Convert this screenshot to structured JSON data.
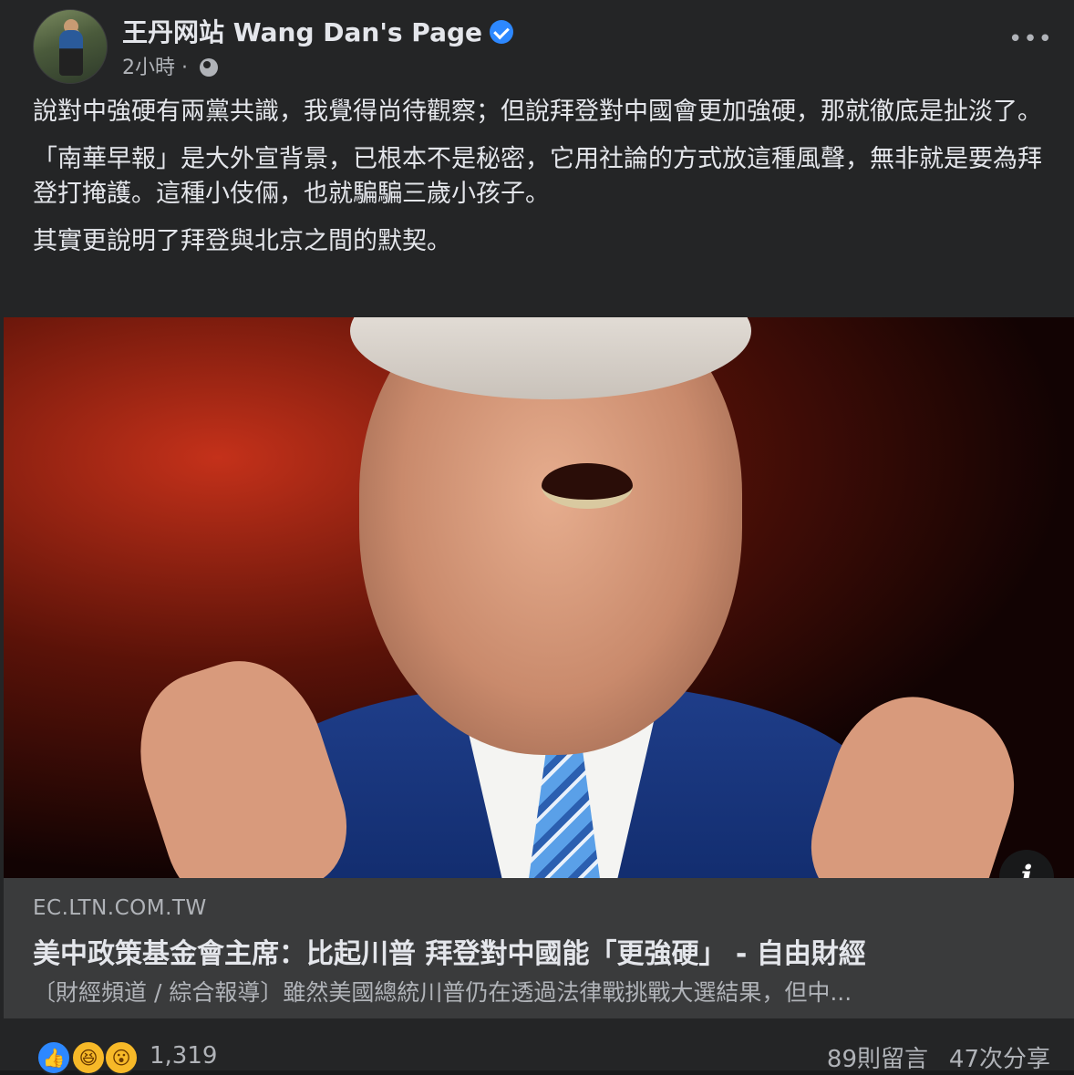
{
  "post": {
    "page_name": "王丹网站 Wang Dan's Page",
    "time": "2小時 · ",
    "paragraphs": [
      "說對中強硬有兩黨共識，我覺得尚待觀察；但說拜登對中國會更加強硬，那就徹底是扯淡了。",
      "「南華早報」是大外宣背景，已根本不是秘密，它用社論的方式放這種風聲，無非就是要為拜登打掩護。這種小伎倆，也就騙騙三歲小孩子。",
      "其實更說明了拜登與北京之間的默契。"
    ],
    "more_label": "•••"
  },
  "link_preview": {
    "domain": "EC.LTN.COM.TW",
    "title": "美中政策基金會主席：比起川普 拜登對中國能「更強硬」 - 自由財經",
    "description": "〔財經頻道 / 綜合報導〕雖然美國總統川普仍在透過法律戰挑戰大選結果，但中...",
    "info_label": "i"
  },
  "footer": {
    "reaction_count": "1,319",
    "comments": "89則留言",
    "shares": "47次分享"
  },
  "icons": {
    "verified": "verified-badge-icon",
    "globe": "globe-icon",
    "more": "more-options-icon",
    "info": "info-icon",
    "like": "like-reaction-icon",
    "haha": "haha-reaction-icon",
    "wow": "wow-reaction-icon"
  },
  "colors": {
    "background": "#242526",
    "text": "#e4e6eb",
    "secondary_text": "#b0b3b8",
    "accent": "#2d88ff",
    "preview_bg": "#3a3b3c"
  }
}
